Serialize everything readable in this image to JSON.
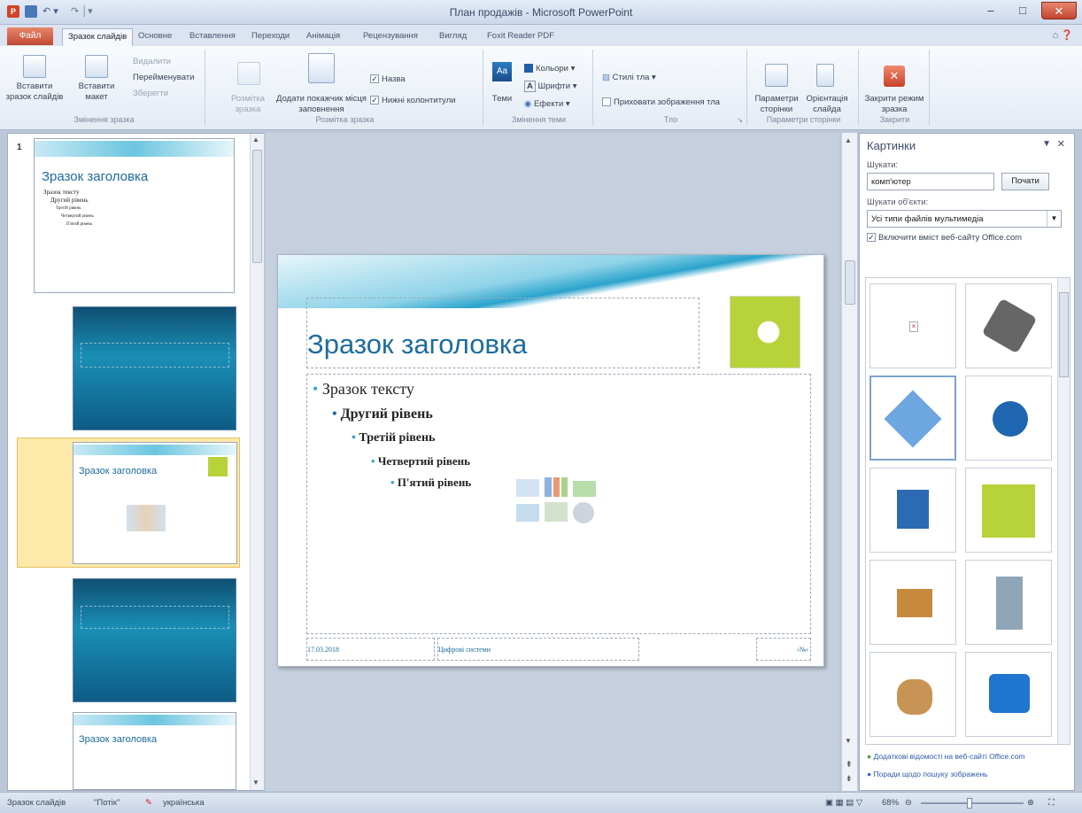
{
  "window": {
    "title": "План продажів - Microsoft PowerPoint",
    "app_icon_letter": "P"
  },
  "tabs": [
    {
      "label": "Файл"
    },
    {
      "label": "Зразок слайдів"
    },
    {
      "label": "Основне"
    },
    {
      "label": "Вставлення"
    },
    {
      "label": "Переходи"
    },
    {
      "label": "Анімація"
    },
    {
      "label": "Рецензування"
    },
    {
      "label": "Вигляд"
    },
    {
      "label": "Foxit Reader PDF"
    }
  ],
  "ribbon": {
    "g1": {
      "insert_master": "Вставити зразок слайдів",
      "insert_layout": "Вставити макет",
      "delete": "Видалити",
      "rename": "Перейменувати",
      "save": "Зберегти",
      "label": "Змінення зразка"
    },
    "g2": {
      "master_layout": "Розмітка зразка",
      "add_placeholder": "Додати покажчик місця заповнення",
      "title_chk": "Назва",
      "footers_chk": "Нижні колонтитули",
      "label": "Розмітка зразка"
    },
    "g3": {
      "themes": "Теми",
      "colors": "Кольори",
      "fonts": "Шрифти",
      "effects": "Ефекти",
      "label": "Змінення теми"
    },
    "g4": {
      "bg_styles": "Стилі тла",
      "hide_bg": "Приховати зображення тла",
      "label": "Тло"
    },
    "g5": {
      "page_setup": "Параметри сторінки",
      "orientation": "Орієнтація слайда",
      "label": "Параметри сторінки"
    },
    "g6": {
      "close_master": "Закрити режим зразка",
      "label": "Закрити"
    }
  },
  "thumbnails": {
    "first_number": "1",
    "title": "Зразок заголовка",
    "bullet1": "Зразок тексту",
    "bullet2": "Другий рівень",
    "bullet3": "Третій рівень",
    "bullet4": "Четвертий рівень",
    "bullet5": "П'ятий рівень"
  },
  "slide": {
    "title": "Зразок заголовка",
    "levels": [
      "Зразок тексту",
      "Другий рівень",
      "Третій рівень",
      "Четвертий рівень",
      "П'ятий рівень"
    ],
    "footer_date": "17.03.2018",
    "footer_text": "Цифрові системи",
    "footer_num": "‹№›"
  },
  "clipart": {
    "header": "Картинки",
    "search_label": "Шукати:",
    "search_value": "комп'ютер",
    "go_button": "Почати",
    "results_label": "Шукати об'єкти:",
    "results_value": "Усі типи файлів мультимедіа",
    "include_office": "Включити вміст веб-сайту Office.com",
    "link1": "Додаткові відомості на веб-сайті Office.com",
    "link2": "Поради щодо пошуку зображень"
  },
  "status": {
    "view": "Зразок слайдів",
    "theme": "\"Потік\"",
    "language": "українська",
    "zoom": "68%"
  },
  "colors": {
    "accent": "#1e87c4",
    "file_tab": "#c94f35",
    "title_color": "#1d6c9e"
  }
}
